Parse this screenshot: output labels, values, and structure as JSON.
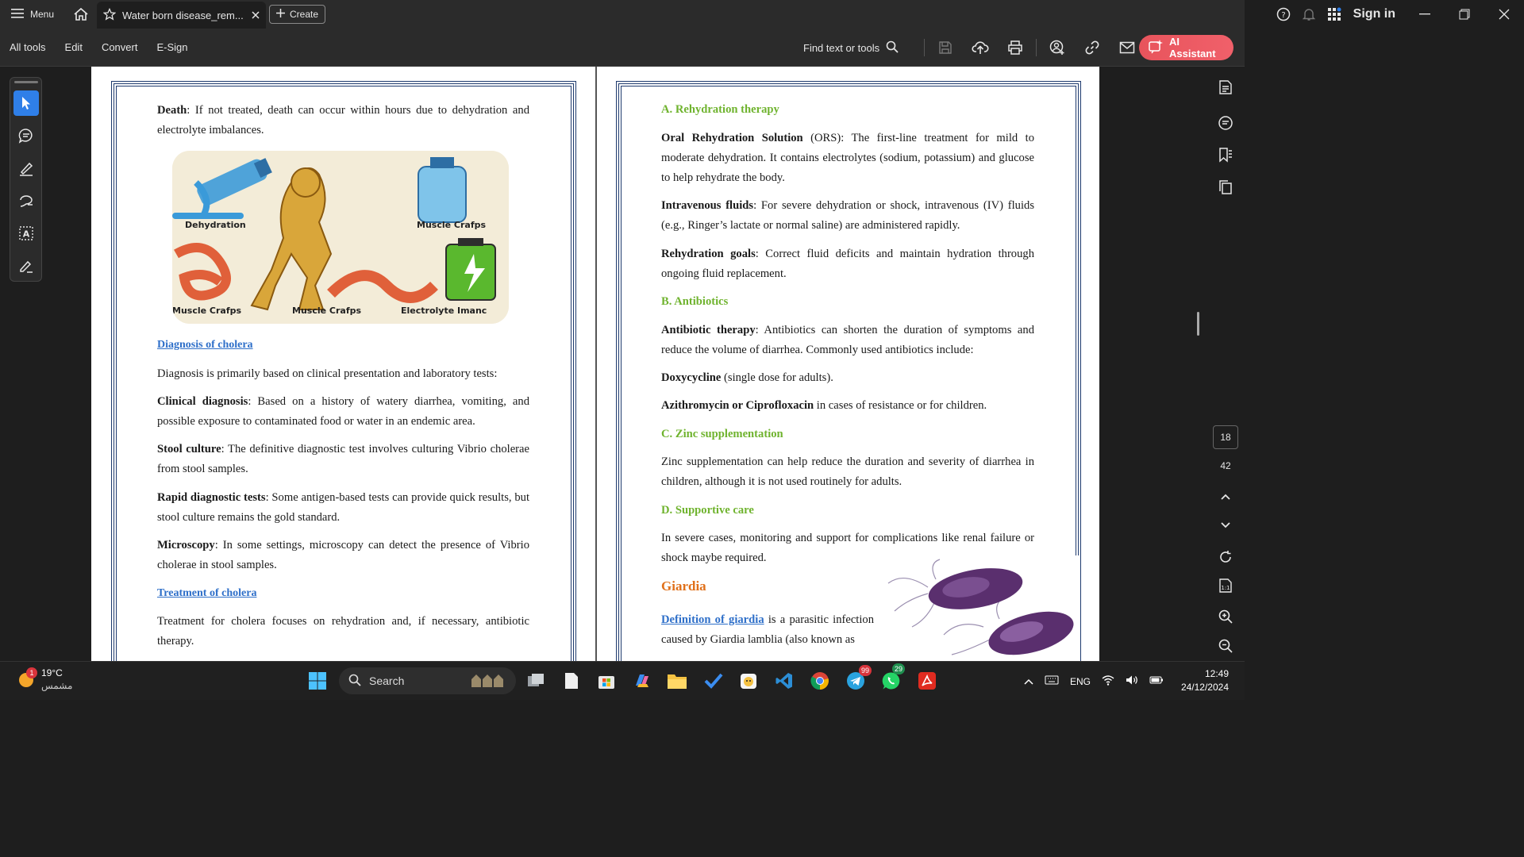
{
  "titlebar": {
    "menu_label": "Menu",
    "tab_title": "Water born disease_rem...",
    "create_label": "Create",
    "sign_in": "Sign in"
  },
  "toolbar": {
    "items": [
      "All tools",
      "Edit",
      "Convert",
      "E-Sign"
    ],
    "find_label": "Find text or tools",
    "ai_label": "AI Assistant"
  },
  "page1": {
    "death_term": "Death",
    "death_text": ": If not treated, death can occur within hours due to dehydration and electrolyte imbalances.",
    "illustration_captions": {
      "dehydration": "Dehydration",
      "muscle_top": "Muscle Crafps",
      "muscle_left": "Muscle Crafps",
      "muscle_mid": "Muscle Crafps",
      "electrolyte": "Electrolyte Imanc"
    },
    "diagnosis_heading": "Diagnosis of cholera",
    "diagnosis_intro": "Diagnosis is primarily based on clinical presentation and laboratory tests:",
    "clinical_term": "Clinical diagnosis",
    "clinical_text": ": Based on a history of watery diarrhea, vomiting, and possible exposure to contaminated food or water in an endemic area.",
    "stool_term": "Stool culture",
    "stool_text": ": The definitive diagnostic test involves culturing Vibrio cholerae from stool samples.",
    "rapid_term": "Rapid diagnostic tests",
    "rapid_text": ": Some antigen-based tests can provide quick results, but stool culture remains the gold standard.",
    "micro_term": "Microscopy",
    "micro_text": ": In some settings, microscopy can detect the presence of Vibrio cholerae in stool samples.",
    "treatment_heading": "Treatment of cholera",
    "treatment_text": "Treatment for cholera focuses on rehydration and, if necessary, antibiotic therapy."
  },
  "page2": {
    "a_heading": "A. Rehydration therapy",
    "ors_term": "Oral Rehydration Solution",
    "ors_text": " (ORS): The first-line treatment for mild to moderate dehydration. It contains electrolytes (sodium, potassium) and glucose to help rehydrate the body.",
    "iv_term": "Intravenous fluids",
    "iv_text": ": For severe dehydration or shock, intravenous (IV) fluids (e.g., Ringer’s lactate or normal saline) are administered rapidly.",
    "goals_term": "Rehydration goals",
    "goals_text": ": Correct fluid deficits and maintain hydration through ongoing fluid replacement.",
    "b_heading": "B. Antibiotics",
    "anti_term": "Antibiotic therapy",
    "anti_text": ": Antibiotics can shorten the duration of symptoms and reduce the volume of diarrhea. Commonly used antibiotics include:",
    "doxy_term": "Doxycycline",
    "doxy_text": " (single dose for adults).",
    "azi_term": "Azithromycin or Ciprofloxacin",
    "azi_text": " in cases of resistance or for children.",
    "c_heading": "C. Zinc supplementation",
    "zinc_text": "Zinc supplementation can help reduce the duration and severity of diarrhea in children, although it is not used routinely for adults.",
    "d_heading": "D. Supportive care",
    "support_text": "In severe cases, monitoring and support for complications like renal failure or shock maybe required.",
    "giardia_heading": "Giardia",
    "giardia_def_link": "Definition of giardia",
    "giardia_def_text": " is a parasitic infection caused by Giardia lamblia (also known as"
  },
  "navigation": {
    "current_page": "18",
    "total_pages": "42"
  },
  "taskbar": {
    "weather_temp": "19°C",
    "weather_cond": "مشمس",
    "weather_badge": "1",
    "search_label": "Search",
    "telegram_badge": "99",
    "whatsapp_badge": "29",
    "lang": "ENG",
    "time": "12:49",
    "date": "24/12/2024"
  },
  "colors": {
    "accent_blue": "#2f7fe8",
    "ai_red": "#e8545c",
    "heading_green": "#6fb32e",
    "heading_blue": "#2e6fc9",
    "heading_orange": "#e0701a",
    "page_border": "#1e3a6e"
  }
}
